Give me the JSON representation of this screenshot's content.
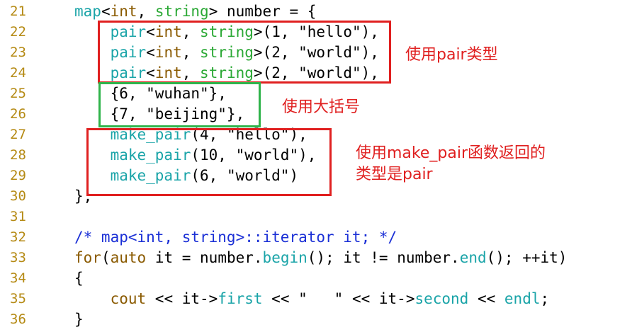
{
  "colors": {
    "line_number": "#b58a14",
    "keyword": "#8a5a00",
    "type": "#2aa834",
    "function": "#1aa4a8",
    "comment": "#1a2fd6",
    "red_box": "#e02020",
    "green_box": "#2fb34a"
  },
  "lines": [
    {
      "num": "21",
      "tokens": [
        [
          "fn",
          "map"
        ],
        [
          "",
          "<"
        ],
        [
          "kw",
          "int"
        ],
        [
          "",
          ", "
        ],
        [
          "ty",
          "string"
        ],
        [
          "",
          "> number = {"
        ]
      ]
    },
    {
      "num": "22",
      "tokens": [
        [
          "",
          "    "
        ],
        [
          "fn",
          "pair"
        ],
        [
          "",
          "<"
        ],
        [
          "kw",
          "int"
        ],
        [
          "",
          ", "
        ],
        [
          "ty",
          "string"
        ],
        [
          "",
          ">(1, \"hello\"),"
        ]
      ]
    },
    {
      "num": "23",
      "tokens": [
        [
          "",
          "    "
        ],
        [
          "fn",
          "pair"
        ],
        [
          "",
          "<"
        ],
        [
          "kw",
          "int"
        ],
        [
          "",
          ", "
        ],
        [
          "ty",
          "string"
        ],
        [
          "",
          ">(2, \"world\"),"
        ]
      ]
    },
    {
      "num": "24",
      "tokens": [
        [
          "",
          "    "
        ],
        [
          "fn",
          "pair"
        ],
        [
          "",
          "<"
        ],
        [
          "kw",
          "int"
        ],
        [
          "",
          ", "
        ],
        [
          "ty",
          "string"
        ],
        [
          "",
          ">(2, \"world\"),"
        ]
      ]
    },
    {
      "num": "25",
      "tokens": [
        [
          "",
          "    {6, \"wuhan\"},"
        ]
      ]
    },
    {
      "num": "26",
      "tokens": [
        [
          "",
          "    {7, \"beijing\"},"
        ]
      ]
    },
    {
      "num": "27",
      "tokens": [
        [
          "",
          "    "
        ],
        [
          "fn",
          "make_pair"
        ],
        [
          "",
          "(4, \"hello\"),"
        ]
      ]
    },
    {
      "num": "28",
      "tokens": [
        [
          "",
          "    "
        ],
        [
          "fn",
          "make_pair"
        ],
        [
          "",
          "(10, \"world\"),"
        ]
      ]
    },
    {
      "num": "29",
      "tokens": [
        [
          "",
          "    "
        ],
        [
          "fn",
          "make_pair"
        ],
        [
          "",
          "(6, \"world\")"
        ]
      ]
    },
    {
      "num": "30",
      "tokens": [
        [
          "",
          "};"
        ]
      ]
    },
    {
      "num": "31",
      "tokens": []
    },
    {
      "num": "32",
      "tokens": [
        [
          "cm",
          "/* map<int, string>::iterator it; */"
        ]
      ]
    },
    {
      "num": "33",
      "tokens": [
        [
          "kw",
          "for"
        ],
        [
          "",
          "("
        ],
        [
          "kw",
          "auto"
        ],
        [
          "",
          " it = number."
        ],
        [
          "fn",
          "begin"
        ],
        [
          "",
          "(); it != number."
        ],
        [
          "fn",
          "end"
        ],
        [
          "",
          "(); ++it)"
        ]
      ]
    },
    {
      "num": "34",
      "tokens": [
        [
          "",
          "{"
        ]
      ]
    },
    {
      "num": "35",
      "tokens": [
        [
          "",
          "    "
        ],
        [
          "kw",
          "cout"
        ],
        [
          "",
          " << it->"
        ],
        [
          "fn",
          "first"
        ],
        [
          "",
          " << \"   \" << it->"
        ],
        [
          "fn",
          "second"
        ],
        [
          "",
          " << "
        ],
        [
          "fn",
          "endl"
        ],
        [
          "",
          ";"
        ]
      ]
    },
    {
      "num": "36",
      "tokens": [
        [
          "",
          "}"
        ]
      ]
    }
  ],
  "annotations": {
    "pair_label": "使用pair类型",
    "brace_label": "使用大括号",
    "make_pair_label_1": "使用make_pair函数返回的",
    "make_pair_label_2": "类型是pair"
  }
}
